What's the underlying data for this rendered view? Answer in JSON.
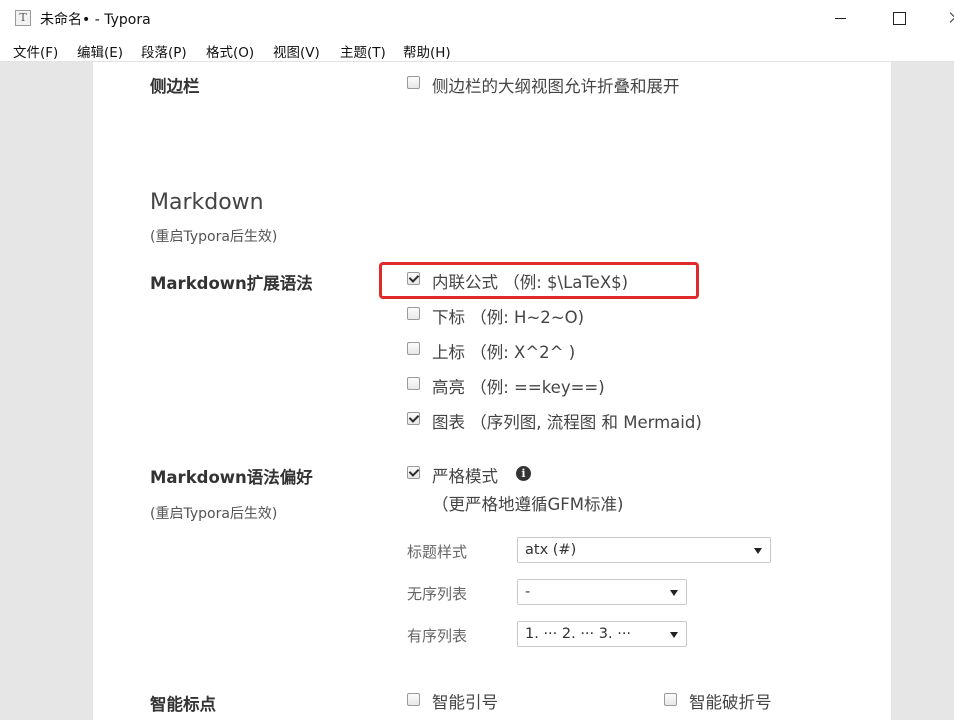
{
  "window": {
    "title": "未命名• - Typora",
    "app_icon": "T"
  },
  "menu": [
    {
      "label": "文件(F)"
    },
    {
      "label": "编辑(E)"
    },
    {
      "label": "段落(P)"
    },
    {
      "label": "格式(O)"
    },
    {
      "label": "视图(V)"
    },
    {
      "label": "主题(T)"
    },
    {
      "label": "帮助(H)"
    }
  ],
  "sidebar_section": {
    "label": "侧边栏",
    "option": {
      "label": "侧边栏的大纲视图允许折叠和展开",
      "checked": false
    }
  },
  "markdown_section": {
    "heading": "Markdown",
    "note": "(重启Typora后生效)"
  },
  "syntax_ext": {
    "label": "Markdown扩展语法",
    "options": [
      {
        "label": "内联公式 （例: $\\LaTeX$)",
        "checked": true
      },
      {
        "label": "下标 （例: H~2~O)",
        "checked": false
      },
      {
        "label": "上标 （例: X^2^ )",
        "checked": false
      },
      {
        "label": "高亮 （例: ==key==)",
        "checked": false
      },
      {
        "label": "图表 （序列图, 流程图 和 Mermaid)",
        "checked": true
      }
    ]
  },
  "syntax_pref": {
    "label": "Markdown语法偏好",
    "note": "(重启Typora后生效)",
    "strict": {
      "label": "严格模式",
      "checked": true,
      "icon": "info-icon",
      "desc": "（更严格地遵循GFM标准)"
    },
    "heading_style": {
      "label": "标题样式",
      "value": "atx (#)"
    },
    "unordered": {
      "label": "无序列表",
      "value": "-"
    },
    "ordered": {
      "label": "有序列表",
      "value": "1. ··· 2. ··· 3. ···"
    }
  },
  "smart_punct": {
    "label": "智能标点",
    "quotes": {
      "label": "智能引号",
      "checked": false
    },
    "dashes": {
      "label": "智能破折号",
      "checked": false
    }
  },
  "colors": {
    "highlight": "#e02b2b",
    "panel_bg": "#ffffff",
    "page_bg": "#e6e6e6"
  }
}
